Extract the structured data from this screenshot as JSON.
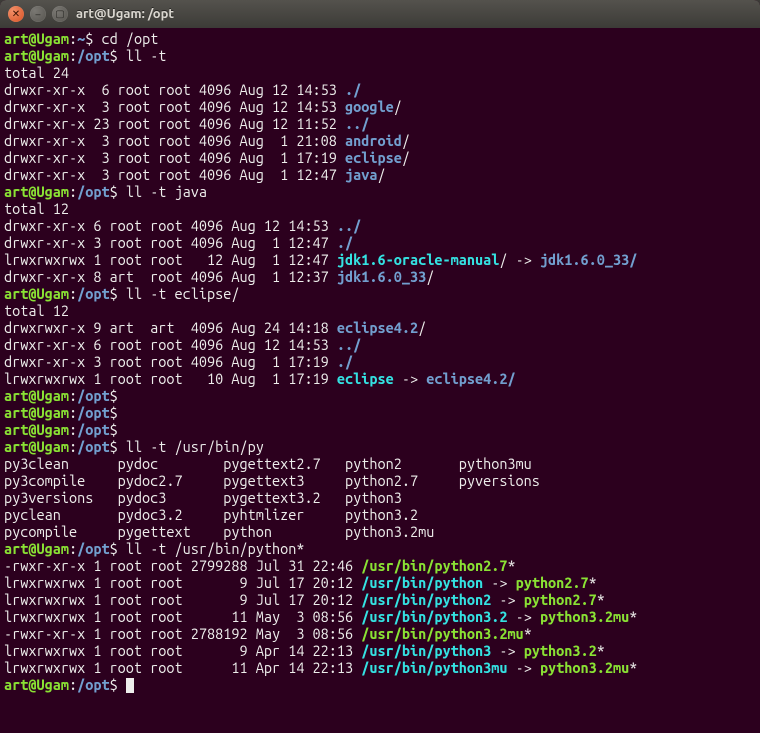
{
  "window": {
    "title": "art@Ugam: /opt"
  },
  "prompt": {
    "user": "art",
    "host": "Ugam",
    "home_path": "~",
    "opt_path": "/opt"
  },
  "cmds": {
    "cd_opt": "cd /opt",
    "ll_t": "ll -t",
    "ll_t_java": "ll -t java",
    "ll_t_eclipse": "ll -t eclipse/",
    "ll_t_py": "ll -t /usr/bin/py",
    "ll_t_python": "ll -t /usr/bin/python*"
  },
  "totals": {
    "t24": "total 24",
    "t12a": "total 12",
    "t12b": "total 12"
  },
  "opt": [
    {
      "perm": "drwxr-xr-x",
      "n": " 6",
      "own": "root root",
      "size": "4096",
      "date": "Aug 12 14:53",
      "name": "./",
      "type": "dir"
    },
    {
      "perm": "drwxr-xr-x",
      "n": " 3",
      "own": "root root",
      "size": "4096",
      "date": "Aug 12 14:53",
      "name": "google",
      "suffix": "/",
      "type": "dir"
    },
    {
      "perm": "drwxr-xr-x",
      "n": "23",
      "own": "root root",
      "size": "4096",
      "date": "Aug 12 11:52",
      "name": "../",
      "type": "dir"
    },
    {
      "perm": "drwxr-xr-x",
      "n": " 3",
      "own": "root root",
      "size": "4096",
      "date": "Aug  1 21:08",
      "name": "android",
      "suffix": "/",
      "type": "dir"
    },
    {
      "perm": "drwxr-xr-x",
      "n": " 3",
      "own": "root root",
      "size": "4096",
      "date": "Aug  1 17:19",
      "name": "eclipse",
      "suffix": "/",
      "type": "dir"
    },
    {
      "perm": "drwxr-xr-x",
      "n": " 3",
      "own": "root root",
      "size": "4096",
      "date": "Aug  1 12:47",
      "name": "java",
      "suffix": "/",
      "type": "dir"
    }
  ],
  "java": [
    {
      "perm": "drwxr-xr-x",
      "n": "6",
      "own": "root root",
      "size": "4096",
      "date": "Aug 12 14:53",
      "name": "../",
      "type": "dir"
    },
    {
      "perm": "drwxr-xr-x",
      "n": "3",
      "own": "root root",
      "size": "4096",
      "date": "Aug  1 12:47",
      "name": "./",
      "type": "dir"
    },
    {
      "perm": "lrwxrwxrwx",
      "n": "1",
      "own": "root root",
      "size": "  12",
      "date": "Aug  1 12:47",
      "name": "jdk1.6-oracle-manual",
      "target": "jdk1.6.0_33/",
      "suffix": "/",
      "type": "link"
    },
    {
      "perm": "drwxr-xr-x",
      "n": "8",
      "own": "art  root",
      "size": "4096",
      "date": "Aug  1 12:37",
      "name": "jdk1.6.0_33",
      "suffix": "/",
      "type": "dir"
    }
  ],
  "eclipse": [
    {
      "perm": "drwxrwxr-x",
      "n": "9",
      "own": "art  art ",
      "size": "4096",
      "date": "Aug 24 14:18",
      "name": "eclipse4.2",
      "suffix": "/",
      "type": "dir"
    },
    {
      "perm": "drwxr-xr-x",
      "n": "6",
      "own": "root root",
      "size": "4096",
      "date": "Aug 12 14:53",
      "name": "../",
      "type": "dir"
    },
    {
      "perm": "drwxr-xr-x",
      "n": "3",
      "own": "root root",
      "size": "4096",
      "date": "Aug  1 17:19",
      "name": "./",
      "type": "dir"
    },
    {
      "perm": "lrwxrwxrwx",
      "n": "1",
      "own": "root root",
      "size": "  10",
      "date": "Aug  1 17:19",
      "name": "eclipse",
      "target": "eclipse4.2/",
      "type": "link"
    }
  ],
  "pytab": [
    [
      "py3clean",
      "pydoc",
      "pygettext2.7",
      "python2",
      "python3mu"
    ],
    [
      "py3compile",
      "pydoc2.7",
      "pygettext3",
      "python2.7",
      "pyversions"
    ],
    [
      "py3versions",
      "pydoc3",
      "pygettext3.2",
      "python3",
      ""
    ],
    [
      "pyclean",
      "pydoc3.2",
      "pyhtmlizer",
      "python3.2",
      ""
    ],
    [
      "pycompile",
      "pygettext",
      "python",
      "python3.2mu",
      ""
    ]
  ],
  "python": [
    {
      "perm": "-rwxr-xr-x",
      "n": "1",
      "own": "root root",
      "size": "2799288",
      "date": "Jul 31 22:46",
      "name": "/usr/bin/python2.7",
      "type": "exec",
      "suffix": "*"
    },
    {
      "perm": "lrwxrwxrwx",
      "n": "1",
      "own": "root root",
      "size": "      9",
      "date": "Jul 17 20:12",
      "name": "/usr/bin/python",
      "target": "python2.7",
      "type": "link",
      "suffix": "*"
    },
    {
      "perm": "lrwxrwxrwx",
      "n": "1",
      "own": "root root",
      "size": "      9",
      "date": "Jul 17 20:12",
      "name": "/usr/bin/python2",
      "target": "python2.7",
      "type": "link",
      "suffix": "*"
    },
    {
      "perm": "lrwxrwxrwx",
      "n": "1",
      "own": "root root",
      "size": "     11",
      "date": "May  3 08:56",
      "name": "/usr/bin/python3.2",
      "target": "python3.2mu",
      "type": "link",
      "suffix": "*"
    },
    {
      "perm": "-rwxr-xr-x",
      "n": "1",
      "own": "root root",
      "size": "2788192",
      "date": "May  3 08:56",
      "name": "/usr/bin/python3.2mu",
      "type": "exec",
      "suffix": "*"
    },
    {
      "perm": "lrwxrwxrwx",
      "n": "1",
      "own": "root root",
      "size": "      9",
      "date": "Apr 14 22:13",
      "name": "/usr/bin/python3",
      "target": "python3.2",
      "type": "link",
      "suffix": "*"
    },
    {
      "perm": "lrwxrwxrwx",
      "n": "1",
      "own": "root root",
      "size": "     11",
      "date": "Apr 14 22:13",
      "name": "/usr/bin/python3mu",
      "target": "python3.2mu",
      "type": "link",
      "suffix": "*"
    }
  ]
}
